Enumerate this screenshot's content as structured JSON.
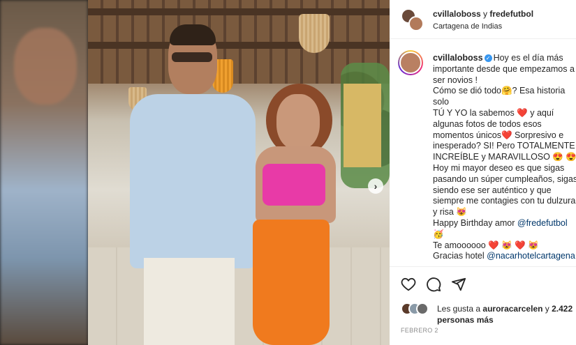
{
  "header": {
    "users_line": "cvillaloboss y fredefutbol",
    "user1": "cvillaloboss",
    "connector": " y ",
    "user2": "fredefutbol",
    "location": "Cartagena de Indias"
  },
  "caption": {
    "username": "cvillaloboss",
    "lines": [
      "Hoy es el día más",
      "importante desde que empezamos a",
      "ser novios !",
      "Cómo se dió todo🤗? Esa historia",
      "solo",
      "TÚ Y YO la sabemos ❤️  y aquí",
      "algunas fotos de todos esos",
      "momentos únicos❤️  Sorpresivo e",
      "inesperado? SI! Pero TOTALMENTE",
      "INCREÍBLE y MARAVILLOSO 😍 😍 😍",
      "Hoy mi mayor deseo es que sigas",
      "pasando un súper cumpleaños, sigas",
      "siendo ese ser auténtico y que",
      "siempre me contagies con tu dulzura",
      "y risa 😻",
      "Happy Birthday amor @fredefutbol",
      "🥳",
      "Te amoooooo ❤️ 😻 ❤️ 😻",
      "Gracias hotel @nacarhotelcartagena"
    ]
  },
  "actions": {
    "like_icon": "heart-icon",
    "comment_icon": "comment-icon",
    "share_icon": "share-icon"
  },
  "likes": {
    "prefix": "Les gusta a ",
    "user": "auroracarcelen",
    "middle": " y ",
    "count": "2.422",
    "suffix": "personas más"
  },
  "date": "FEBRERO 2",
  "carousel": {
    "next_icon": "chevron-right-icon",
    "next_glyph": "›"
  },
  "colors": {
    "verified": "#3897f0",
    "mention": "#00376b",
    "text": "#262626",
    "muted": "#8e8e8e"
  }
}
